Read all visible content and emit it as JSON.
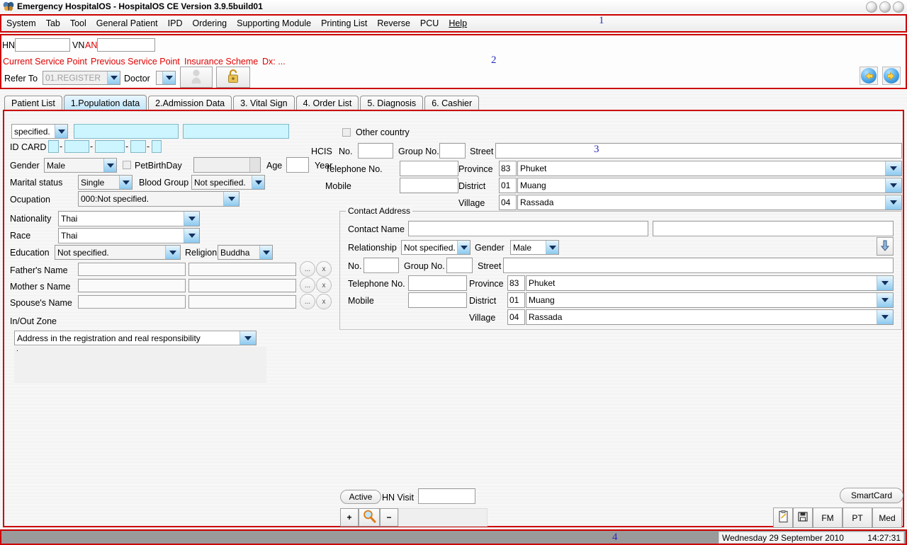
{
  "window": {
    "title": "Emergency  HospitalOS - HospitalOS CE Version 3.9.5build01",
    "app_icon": "butterfly-icon",
    "buttons": [
      "minimize",
      "maximize",
      "close"
    ]
  },
  "menu": {
    "items": [
      {
        "label": "System"
      },
      {
        "label": "Tab"
      },
      {
        "label": "Tool"
      },
      {
        "label": "General Patient"
      },
      {
        "label": "IPD"
      },
      {
        "label": "Ordering"
      },
      {
        "label": "Supporting Module"
      },
      {
        "label": "Printing List"
      },
      {
        "label": "Reverse"
      },
      {
        "label": "PCU"
      },
      {
        "label": "Help"
      }
    ]
  },
  "annotations": [
    {
      "id": "1",
      "label": "1"
    },
    {
      "id": "2",
      "label": "2"
    },
    {
      "id": "3",
      "label": "3"
    },
    {
      "id": "4",
      "label": "4"
    }
  ],
  "patient_bar": {
    "hn_label": "HN",
    "hn_value": "",
    "vn_label": "VN",
    "an_label": "AN",
    "an_value": "",
    "links": [
      {
        "label": "Current Service Point"
      },
      {
        "label": "Previous Service Point"
      },
      {
        "label": "Insurance Scheme"
      },
      {
        "label": "Dx: ..."
      }
    ],
    "refer_to_label": "Refer To",
    "refer_to_value": "01.REGISTER",
    "doctor_label": "Doctor",
    "doctor_value": "",
    "person_icon": "person-icon",
    "lock_icon": "lock-icon",
    "prev_icon": "arrow-left-icon",
    "next_icon": "arrow-right-icon"
  },
  "tabs": [
    {
      "label": "Patient List",
      "active": false
    },
    {
      "label": "1.Population data",
      "active": true
    },
    {
      "label": "2.Admission Data",
      "active": false
    },
    {
      "label": "3. Vital Sign",
      "active": false
    },
    {
      "label": "4. Order List",
      "active": false
    },
    {
      "label": "5. Diagnosis",
      "active": false
    },
    {
      "label": "6. Cashier",
      "active": false
    }
  ],
  "form": {
    "prefix_value": "specified.",
    "firstname_value": "",
    "lastname_value": "",
    "idcard_label": "ID CARD",
    "idcard_parts": [
      "",
      "",
      "",
      "",
      ""
    ],
    "gender_label": "Gender",
    "gender_value": "Male",
    "petbirthday_label": "PetBirthDay",
    "petbirthday_checked": false,
    "birthdate_value": "",
    "age_label": "Age",
    "age_value": "",
    "year_label": "Year",
    "marital_label": "Marital status",
    "marital_value": "Single",
    "blood_label": "Blood Group",
    "blood_value": "Not specified.",
    "occupation_label": "Ocupation",
    "occupation_value": "000:Not specified.",
    "nationality_label": "Nationality",
    "nationality_value": "Thai",
    "race_label": "Race",
    "race_value": "Thai",
    "education_label": "Education",
    "education_value": "Not specified.",
    "religion_label": "Religion",
    "religion_value": "Buddha",
    "father_label": "Father's Name",
    "father_first": "",
    "father_last": "",
    "mother_label": "Mother s Name",
    "mother_first": "",
    "mother_last": "",
    "spouse_label": "Spouse's Name",
    "spouse_first": "",
    "spouse_last": "",
    "browse_btn": "...",
    "clear_btn": "x",
    "inout_label": "In/Out Zone",
    "inout_value": "Address in the registration and real responsibility",
    "inout_note": "."
  },
  "address": {
    "other_country_label": "Other country",
    "other_country_checked": false,
    "hcis_label": "HCIS",
    "no_label": "No.",
    "no_value": "",
    "group_no_label": "Group No.",
    "group_no_value": "",
    "street_label": "Street",
    "street_value": "",
    "telephone_label": "Telephone No.",
    "telephone_value": "",
    "mobile_label": "Mobile",
    "mobile_value": "",
    "province_label": "Province",
    "province_code": "83",
    "province_value": "Phuket",
    "district_label": "District",
    "district_code": "01",
    "district_value": "Muang",
    "village_label": "Village",
    "village_code": "04",
    "village_value": "Rassada"
  },
  "contact": {
    "caption": "Contact Address",
    "contact_name_label": "Contact Name",
    "contact_first": "",
    "contact_last": "",
    "relationship_label": "Relationship",
    "relationship_value": "Not specified.",
    "gender_label": "Gender",
    "gender_value": "Male",
    "copy_icon": "arrow-down-icon",
    "no_label": "No.",
    "no_value": "",
    "group_no_label": "Group No.",
    "group_no_value": "",
    "street_label": "Street",
    "street_value": "",
    "telephone_label": "Telephone No.",
    "telephone_value": "",
    "mobile_label": "Mobile",
    "mobile_value": "",
    "province_label": "Province",
    "province_code": "83",
    "province_value": "Phuket",
    "district_label": "District",
    "district_code": "01",
    "district_value": "Muang",
    "village_label": "Village",
    "village_code": "04",
    "village_value": "Rassada"
  },
  "bottom": {
    "active_label": "Active",
    "hn_visit_label": "HN Visit",
    "hn_visit_value": "",
    "add_label": "+",
    "search_icon": "magnifier-icon",
    "remove_label": "−",
    "smartcard_label": "SmartCard",
    "note_icon": "clipboard-icon",
    "save_icon": "floppy-disk-icon",
    "fm_label": "FM",
    "pt_label": "PT",
    "med_label": "Med"
  },
  "status": {
    "date": "Wednesday 29 September 2010",
    "time": "14:27:31"
  }
}
